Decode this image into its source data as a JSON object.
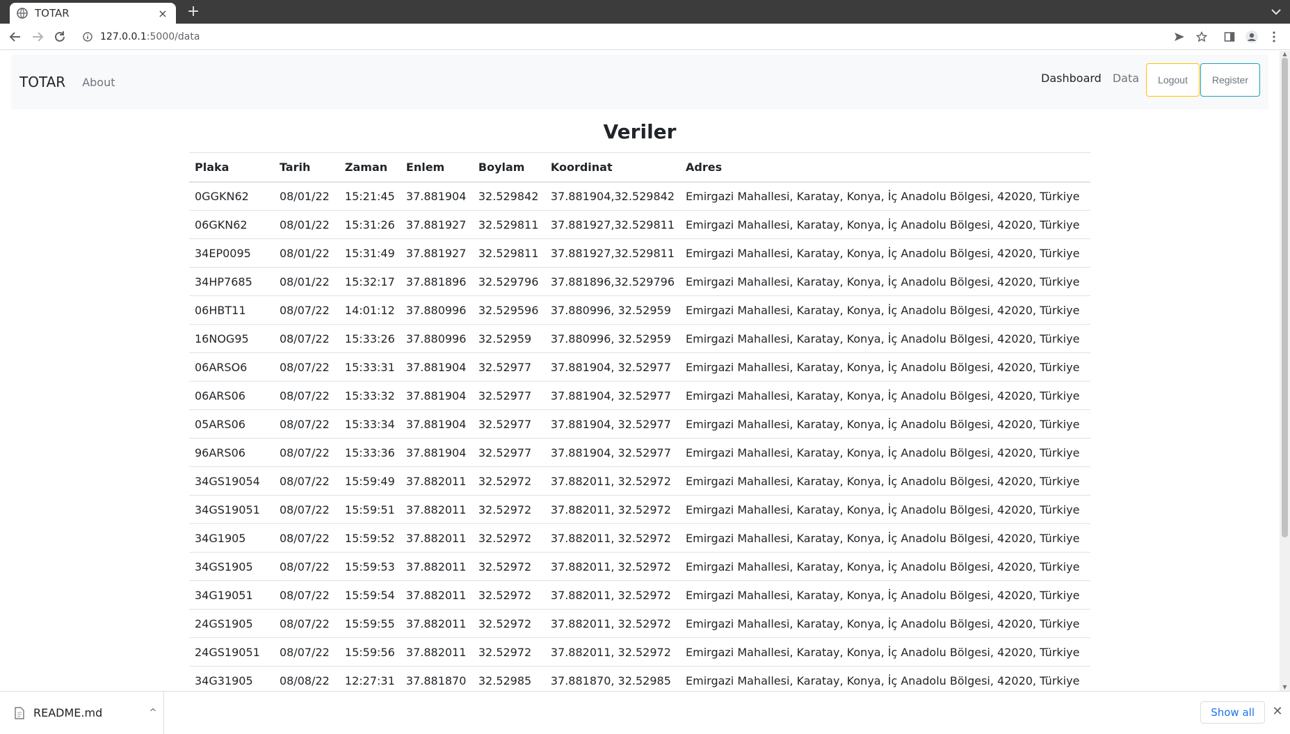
{
  "browser": {
    "tab_title": "TOTAR",
    "tab_close": "×",
    "new_tab": "+",
    "url_host": "127.0.0.1",
    "url_path": ":5000/data",
    "icons": [
      "back-icon",
      "forward-icon",
      "reload-icon",
      "info-icon",
      "send-icon",
      "star-icon",
      "sidepanel-icon",
      "profile-icon",
      "menu-icon"
    ]
  },
  "navbar": {
    "brand": "TOTAR",
    "about": "About",
    "dashboard": "Dashboard",
    "data": "Data",
    "logout": "Logout",
    "register": "Register",
    "logout_border": "#ffc107",
    "register_border": "#17a2b8"
  },
  "main": {
    "heading": "Veriler",
    "columns": [
      "Plaka",
      "Tarih",
      "Zaman",
      "Enlem",
      "Boylam",
      "Koordinat",
      "Adres"
    ],
    "rows": [
      [
        "0GGKN62",
        "08/01/22",
        "15:21:45",
        "37.881904",
        "32.529842",
        "37.881904,32.529842",
        "Emirgazi Mahallesi, Karatay, Konya, İç Anadolu Bölgesi, 42020, Türkiye"
      ],
      [
        "06GKN62",
        "08/01/22",
        "15:31:26",
        "37.881927",
        "32.529811",
        "37.881927,32.529811",
        "Emirgazi Mahallesi, Karatay, Konya, İç Anadolu Bölgesi, 42020, Türkiye"
      ],
      [
        "34EP0095",
        "08/01/22",
        "15:31:49",
        "37.881927",
        "32.529811",
        "37.881927,32.529811",
        "Emirgazi Mahallesi, Karatay, Konya, İç Anadolu Bölgesi, 42020, Türkiye"
      ],
      [
        "34HP7685",
        "08/01/22",
        "15:32:17",
        "37.881896",
        "32.529796",
        "37.881896,32.529796",
        "Emirgazi Mahallesi, Karatay, Konya, İç Anadolu Bölgesi, 42020, Türkiye"
      ],
      [
        "06HBT11",
        "08/07/22",
        "14:01:12",
        "37.880996",
        "32.529596",
        "37.880996, 32.52959",
        "Emirgazi Mahallesi, Karatay, Konya, İç Anadolu Bölgesi, 42020, Türkiye"
      ],
      [
        "16NOG95",
        "08/07/22",
        "15:33:26",
        "37.880996",
        "32.52959",
        "37.880996, 32.52959",
        "Emirgazi Mahallesi, Karatay, Konya, İç Anadolu Bölgesi, 42020, Türkiye"
      ],
      [
        "06ARSO6",
        "08/07/22",
        "15:33:31",
        "37.881904",
        "32.52977",
        "37.881904, 32.52977",
        "Emirgazi Mahallesi, Karatay, Konya, İç Anadolu Bölgesi, 42020, Türkiye"
      ],
      [
        "06ARS06",
        "08/07/22",
        "15:33:32",
        "37.881904",
        "32.52977",
        "37.881904, 32.52977",
        "Emirgazi Mahallesi, Karatay, Konya, İç Anadolu Bölgesi, 42020, Türkiye"
      ],
      [
        "05ARS06",
        "08/07/22",
        "15:33:34",
        "37.881904",
        "32.52977",
        "37.881904, 32.52977",
        "Emirgazi Mahallesi, Karatay, Konya, İç Anadolu Bölgesi, 42020, Türkiye"
      ],
      [
        "96ARS06",
        "08/07/22",
        "15:33:36",
        "37.881904",
        "32.52977",
        "37.881904, 32.52977",
        "Emirgazi Mahallesi, Karatay, Konya, İç Anadolu Bölgesi, 42020, Türkiye"
      ],
      [
        "34GS19054",
        "08/07/22",
        "15:59:49",
        "37.882011",
        "32.52972",
        "37.882011, 32.52972",
        "Emirgazi Mahallesi, Karatay, Konya, İç Anadolu Bölgesi, 42020, Türkiye"
      ],
      [
        "34GS19051",
        "08/07/22",
        "15:59:51",
        "37.882011",
        "32.52972",
        "37.882011, 32.52972",
        "Emirgazi Mahallesi, Karatay, Konya, İç Anadolu Bölgesi, 42020, Türkiye"
      ],
      [
        "34G1905",
        "08/07/22",
        "15:59:52",
        "37.882011",
        "32.52972",
        "37.882011, 32.52972",
        "Emirgazi Mahallesi, Karatay, Konya, İç Anadolu Bölgesi, 42020, Türkiye"
      ],
      [
        "34GS1905",
        "08/07/22",
        "15:59:53",
        "37.882011",
        "32.52972",
        "37.882011, 32.52972",
        "Emirgazi Mahallesi, Karatay, Konya, İç Anadolu Bölgesi, 42020, Türkiye"
      ],
      [
        "34G19051",
        "08/07/22",
        "15:59:54",
        "37.882011",
        "32.52972",
        "37.882011, 32.52972",
        "Emirgazi Mahallesi, Karatay, Konya, İç Anadolu Bölgesi, 42020, Türkiye"
      ],
      [
        "24GS1905",
        "08/07/22",
        "15:59:55",
        "37.882011",
        "32.52972",
        "37.882011, 32.52972",
        "Emirgazi Mahallesi, Karatay, Konya, İç Anadolu Bölgesi, 42020, Türkiye"
      ],
      [
        "24GS19051",
        "08/07/22",
        "15:59:56",
        "37.882011",
        "32.52972",
        "37.882011, 32.52972",
        "Emirgazi Mahallesi, Karatay, Konya, İç Anadolu Bölgesi, 42020, Türkiye"
      ],
      [
        "34G31905",
        "08/08/22",
        "12:27:31",
        "37.881870",
        "32.52985",
        "37.881870, 32.52985",
        "Emirgazi Mahallesi, Karatay, Konya, İç Anadolu Bölgesi, 42020, Türkiye"
      ]
    ]
  },
  "downloads": {
    "file_name": "README.md",
    "chevron": "^",
    "show_all": "Show all",
    "close": "✕"
  }
}
